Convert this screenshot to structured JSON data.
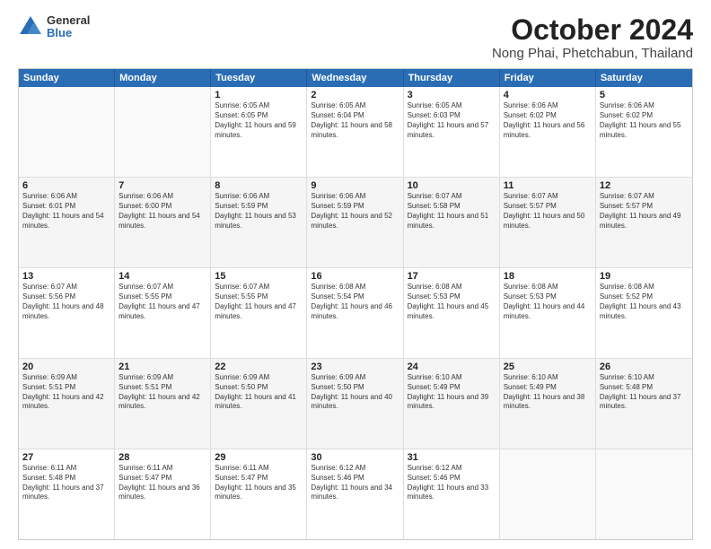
{
  "logo": {
    "general": "General",
    "blue": "Blue"
  },
  "title": "October 2024",
  "location": "Nong Phai, Phetchabun, Thailand",
  "days_of_week": [
    "Sunday",
    "Monday",
    "Tuesday",
    "Wednesday",
    "Thursday",
    "Friday",
    "Saturday"
  ],
  "weeks": [
    [
      {
        "day": "",
        "sunrise": "",
        "sunset": "",
        "daylight": "",
        "empty": true
      },
      {
        "day": "",
        "sunrise": "",
        "sunset": "",
        "daylight": "",
        "empty": true
      },
      {
        "day": "1",
        "sunrise": "Sunrise: 6:05 AM",
        "sunset": "Sunset: 6:05 PM",
        "daylight": "Daylight: 11 hours and 59 minutes."
      },
      {
        "day": "2",
        "sunrise": "Sunrise: 6:05 AM",
        "sunset": "Sunset: 6:04 PM",
        "daylight": "Daylight: 11 hours and 58 minutes."
      },
      {
        "day": "3",
        "sunrise": "Sunrise: 6:05 AM",
        "sunset": "Sunset: 6:03 PM",
        "daylight": "Daylight: 11 hours and 57 minutes."
      },
      {
        "day": "4",
        "sunrise": "Sunrise: 6:06 AM",
        "sunset": "Sunset: 6:02 PM",
        "daylight": "Daylight: 11 hours and 56 minutes."
      },
      {
        "day": "5",
        "sunrise": "Sunrise: 6:06 AM",
        "sunset": "Sunset: 6:02 PM",
        "daylight": "Daylight: 11 hours and 55 minutes."
      }
    ],
    [
      {
        "day": "6",
        "sunrise": "Sunrise: 6:06 AM",
        "sunset": "Sunset: 6:01 PM",
        "daylight": "Daylight: 11 hours and 54 minutes."
      },
      {
        "day": "7",
        "sunrise": "Sunrise: 6:06 AM",
        "sunset": "Sunset: 6:00 PM",
        "daylight": "Daylight: 11 hours and 54 minutes."
      },
      {
        "day": "8",
        "sunrise": "Sunrise: 6:06 AM",
        "sunset": "Sunset: 5:59 PM",
        "daylight": "Daylight: 11 hours and 53 minutes."
      },
      {
        "day": "9",
        "sunrise": "Sunrise: 6:06 AM",
        "sunset": "Sunset: 5:59 PM",
        "daylight": "Daylight: 11 hours and 52 minutes."
      },
      {
        "day": "10",
        "sunrise": "Sunrise: 6:07 AM",
        "sunset": "Sunset: 5:58 PM",
        "daylight": "Daylight: 11 hours and 51 minutes."
      },
      {
        "day": "11",
        "sunrise": "Sunrise: 6:07 AM",
        "sunset": "Sunset: 5:57 PM",
        "daylight": "Daylight: 11 hours and 50 minutes."
      },
      {
        "day": "12",
        "sunrise": "Sunrise: 6:07 AM",
        "sunset": "Sunset: 5:57 PM",
        "daylight": "Daylight: 11 hours and 49 minutes."
      }
    ],
    [
      {
        "day": "13",
        "sunrise": "Sunrise: 6:07 AM",
        "sunset": "Sunset: 5:56 PM",
        "daylight": "Daylight: 11 hours and 48 minutes."
      },
      {
        "day": "14",
        "sunrise": "Sunrise: 6:07 AM",
        "sunset": "Sunset: 5:55 PM",
        "daylight": "Daylight: 11 hours and 47 minutes."
      },
      {
        "day": "15",
        "sunrise": "Sunrise: 6:07 AM",
        "sunset": "Sunset: 5:55 PM",
        "daylight": "Daylight: 11 hours and 47 minutes."
      },
      {
        "day": "16",
        "sunrise": "Sunrise: 6:08 AM",
        "sunset": "Sunset: 5:54 PM",
        "daylight": "Daylight: 11 hours and 46 minutes."
      },
      {
        "day": "17",
        "sunrise": "Sunrise: 6:08 AM",
        "sunset": "Sunset: 5:53 PM",
        "daylight": "Daylight: 11 hours and 45 minutes."
      },
      {
        "day": "18",
        "sunrise": "Sunrise: 6:08 AM",
        "sunset": "Sunset: 5:53 PM",
        "daylight": "Daylight: 11 hours and 44 minutes."
      },
      {
        "day": "19",
        "sunrise": "Sunrise: 6:08 AM",
        "sunset": "Sunset: 5:52 PM",
        "daylight": "Daylight: 11 hours and 43 minutes."
      }
    ],
    [
      {
        "day": "20",
        "sunrise": "Sunrise: 6:09 AM",
        "sunset": "Sunset: 5:51 PM",
        "daylight": "Daylight: 11 hours and 42 minutes."
      },
      {
        "day": "21",
        "sunrise": "Sunrise: 6:09 AM",
        "sunset": "Sunset: 5:51 PM",
        "daylight": "Daylight: 11 hours and 42 minutes."
      },
      {
        "day": "22",
        "sunrise": "Sunrise: 6:09 AM",
        "sunset": "Sunset: 5:50 PM",
        "daylight": "Daylight: 11 hours and 41 minutes."
      },
      {
        "day": "23",
        "sunrise": "Sunrise: 6:09 AM",
        "sunset": "Sunset: 5:50 PM",
        "daylight": "Daylight: 11 hours and 40 minutes."
      },
      {
        "day": "24",
        "sunrise": "Sunrise: 6:10 AM",
        "sunset": "Sunset: 5:49 PM",
        "daylight": "Daylight: 11 hours and 39 minutes."
      },
      {
        "day": "25",
        "sunrise": "Sunrise: 6:10 AM",
        "sunset": "Sunset: 5:49 PM",
        "daylight": "Daylight: 11 hours and 38 minutes."
      },
      {
        "day": "26",
        "sunrise": "Sunrise: 6:10 AM",
        "sunset": "Sunset: 5:48 PM",
        "daylight": "Daylight: 11 hours and 37 minutes."
      }
    ],
    [
      {
        "day": "27",
        "sunrise": "Sunrise: 6:11 AM",
        "sunset": "Sunset: 5:48 PM",
        "daylight": "Daylight: 11 hours and 37 minutes."
      },
      {
        "day": "28",
        "sunrise": "Sunrise: 6:11 AM",
        "sunset": "Sunset: 5:47 PM",
        "daylight": "Daylight: 11 hours and 36 minutes."
      },
      {
        "day": "29",
        "sunrise": "Sunrise: 6:11 AM",
        "sunset": "Sunset: 5:47 PM",
        "daylight": "Daylight: 11 hours and 35 minutes."
      },
      {
        "day": "30",
        "sunrise": "Sunrise: 6:12 AM",
        "sunset": "Sunset: 5:46 PM",
        "daylight": "Daylight: 11 hours and 34 minutes."
      },
      {
        "day": "31",
        "sunrise": "Sunrise: 6:12 AM",
        "sunset": "Sunset: 5:46 PM",
        "daylight": "Daylight: 11 hours and 33 minutes."
      },
      {
        "day": "",
        "sunrise": "",
        "sunset": "",
        "daylight": "",
        "empty": true
      },
      {
        "day": "",
        "sunrise": "",
        "sunset": "",
        "daylight": "",
        "empty": true
      }
    ]
  ],
  "alt_rows": [
    1,
    3
  ]
}
